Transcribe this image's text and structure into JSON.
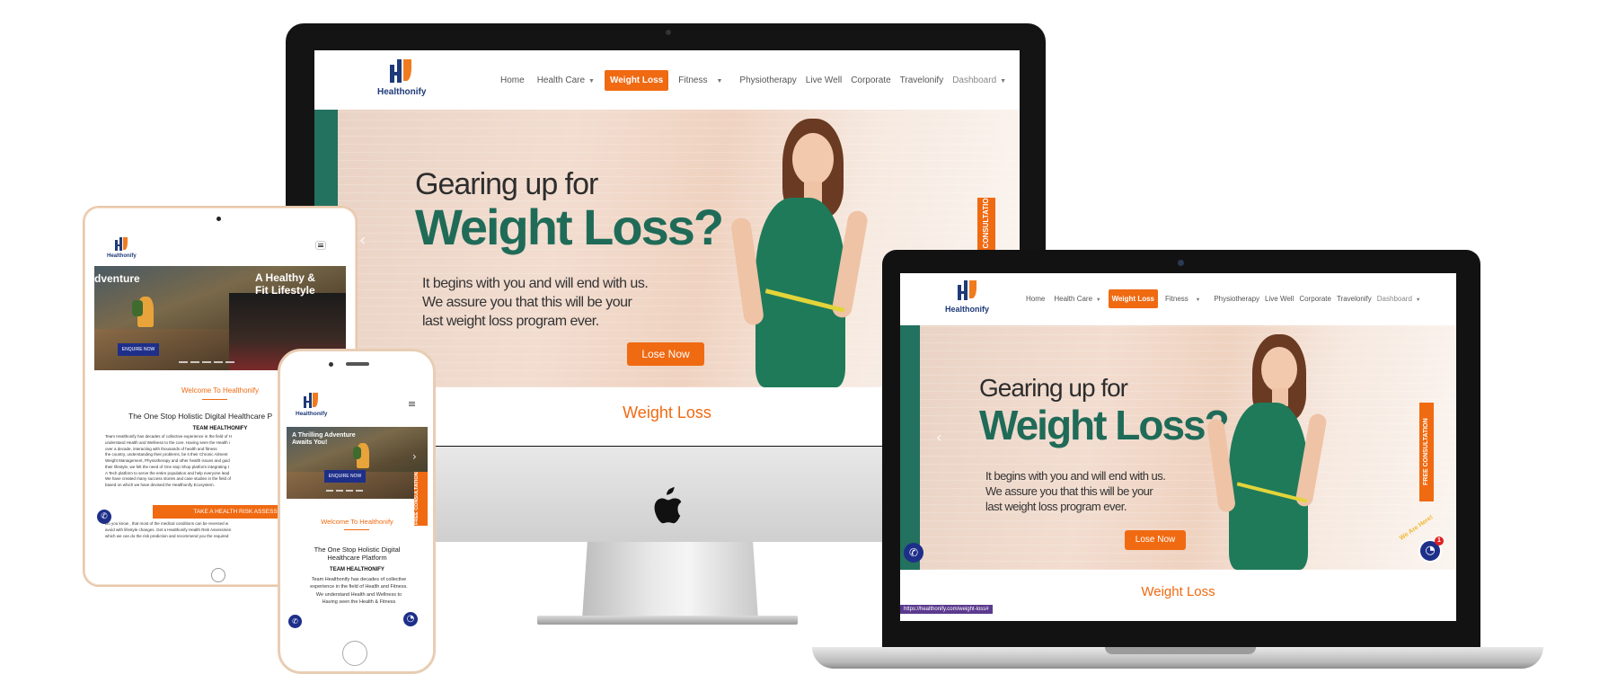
{
  "brand": {
    "name": "Healthonify",
    "colors": {
      "orange": "#f06a12",
      "navy": "#1e3a78",
      "teal": "#1f6b58"
    }
  },
  "desktop_nav": {
    "items": [
      {
        "label": "Home"
      },
      {
        "label": "Health Care"
      },
      {
        "label": "Weight Loss",
        "active": true
      },
      {
        "label": "Fitness"
      },
      {
        "label": "Physiotherapy"
      },
      {
        "label": "Live Well"
      },
      {
        "label": "Corporate"
      },
      {
        "label": "Travelonify"
      },
      {
        "label": "Dashboard"
      }
    ]
  },
  "hero": {
    "heading_line1": "Gearing up for",
    "heading_line2": "Weight Loss?",
    "text_line1": "It begins with you and will end with us.",
    "text_line2": "We assure you that this will be your",
    "text_line3": "last weight loss program ever.",
    "cta": "Lose Now",
    "side_tab": "FREE CONSULTATION"
  },
  "section_title": "Weight Loss",
  "laptop": {
    "status_url": "https://healthonify.com/weight-loss#",
    "chat_badge": "1",
    "chat_bubble_label": "We Are Here!"
  },
  "tablet": {
    "slide_title_left": "dventure",
    "slide_title_line1": "A Healthy &",
    "slide_title_line2": "Fit Lifestyle",
    "enquire": "ENQUIRE NOW",
    "welcome": "Welcome To Healthonify",
    "headline": "The One Stop Holistic Digital Healthcare P",
    "team": "TEAM HEALTHONIFY",
    "body": [
      "Team Healthonify has decades of collective experience in the field of H",
      "understand Health and Wellness to the core. Having seen the Health i",
      "over a decade, interacting with thousands of health and fitness ",
      "the country, understanding their problems, be it their Chronic Ailment",
      "Weight Management, Physiotherapy and other health issues and guid",
      "their lifestyle, we felt the need of One stop Shop platform integrating t",
      "A Tech platform to serve the entire population and help everyone lead",
      "We have created many success stories and case studies in the field of",
      "based on which we have devised the Healthonify Ecosystem."
    ],
    "assessment_btn": "TAKE A HEALTH RISK ASSESSMENT NOW",
    "did_you_know": [
      "Do you know , that most of the medical conditions can be reversed w",
      "avoid with lifestyle changes. Get a Healthonify Health Risk Assessmen",
      "which we can do the risk prediction and recommend you the required"
    ]
  },
  "phone": {
    "slide_title_line1": "A Thrilling Adventure",
    "slide_title_line2": "Awaits You!",
    "enquire": "ENQUIRE NOW",
    "side_tab": "FREE CONSULTATION",
    "welcome": "Welcome To Healthonify",
    "headline_line1": "The One Stop Holistic Digital",
    "headline_line2": "Healthcare Platform",
    "team": "TEAM HEALTHONIFY",
    "body": [
      "Team Healthonify has decades of collective",
      "experience in the field of Health and Fitness.",
      "We understand Health and Wellness to",
      "Having seen the Health & Fitness"
    ]
  },
  "icons": [
    "apple-icon",
    "phone-icon",
    "chat-icon",
    "chevron-left-icon",
    "menu-icon",
    "caret-down-icon"
  ]
}
